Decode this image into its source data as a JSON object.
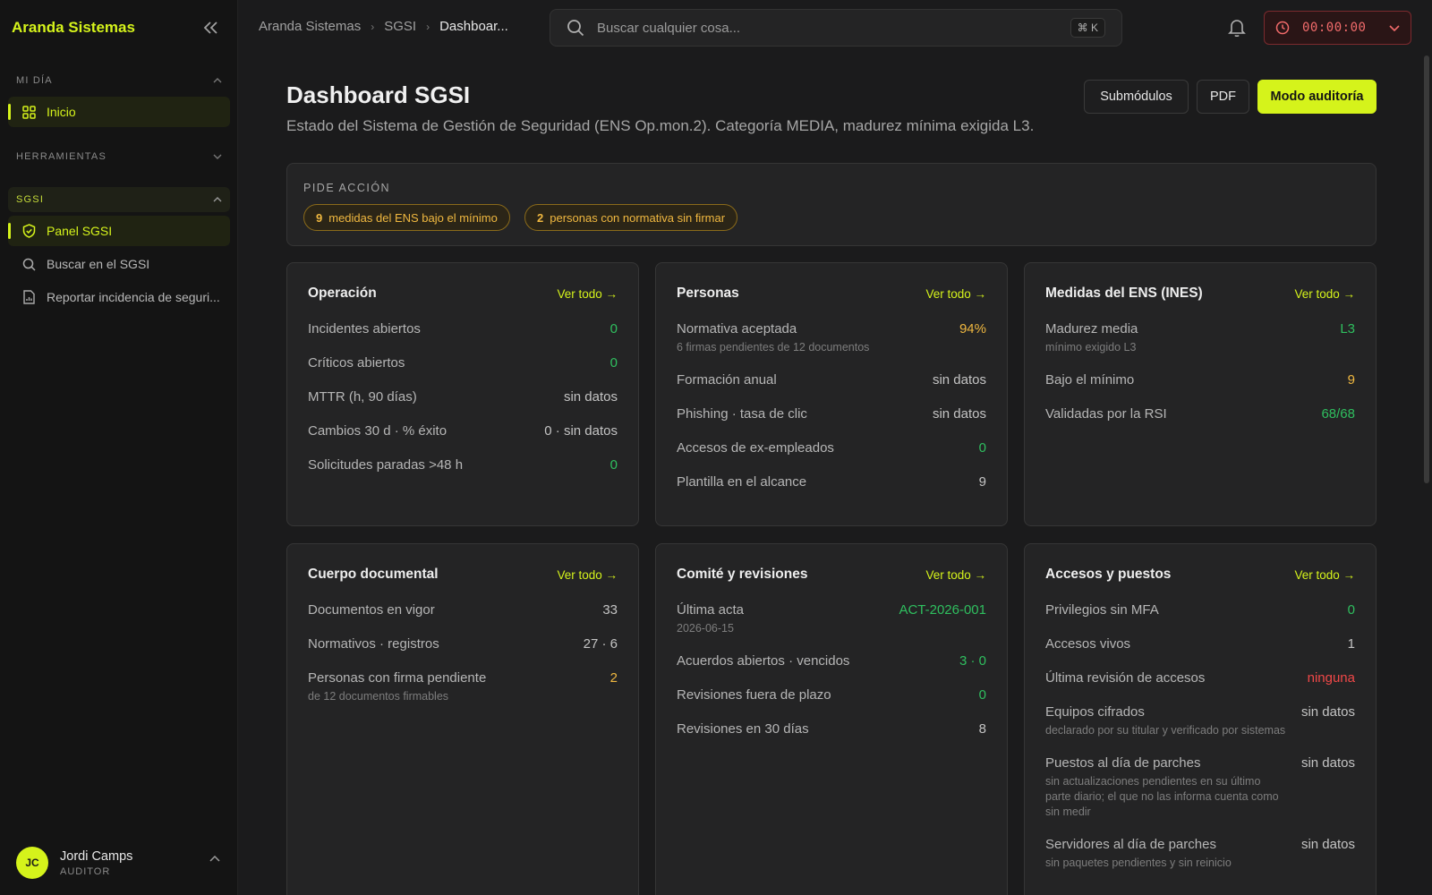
{
  "app": {
    "brand": "Aranda Sistemas"
  },
  "sidebar": {
    "sections": [
      {
        "label": "MI DÍA"
      },
      {
        "label": "HERRAMIENTAS"
      },
      {
        "label": "SGSI"
      }
    ],
    "items": [
      {
        "label": "Inicio",
        "icon": "grid-icon"
      },
      {
        "label": "Panel SGSI",
        "icon": "shield-check-icon"
      },
      {
        "label": "Buscar en el SGSI",
        "icon": "search-icon"
      },
      {
        "label": "Reportar incidencia de seguri...",
        "icon": "document-report-icon"
      }
    ],
    "user": {
      "initials": "JC",
      "name": "Jordi Camps",
      "role": "AUDITOR"
    }
  },
  "breadcrumb": [
    "Aranda Sistemas",
    "SGSI",
    "Dashboar..."
  ],
  "search": {
    "placeholder": "Buscar cualquier cosa...",
    "shortcut": "⌘ K"
  },
  "timer": {
    "value": "00:00:00"
  },
  "page": {
    "title": "Dashboard SGSI",
    "subtitle": "Estado del Sistema de Gestión de Seguridad (ENS Op.mon.2). Categoría MEDIA, madurez mínima exigida L3.",
    "buttons": {
      "submodules": "Submódulos",
      "pdf": "PDF",
      "audit": "Modo auditoría"
    }
  },
  "action_banner": {
    "title": "PIDE ACCIÓN",
    "pills": [
      {
        "count": "9",
        "text": "medidas del ENS bajo el mínimo"
      },
      {
        "count": "2",
        "text": "personas con normativa sin firmar"
      }
    ]
  },
  "cards": {
    "link_label": "Ver todo →",
    "operacion": {
      "title": "Operación",
      "rows": [
        {
          "label": "Incidentes abiertos",
          "value": "0"
        },
        {
          "label": "Críticos abiertos",
          "value": "0"
        },
        {
          "label": "MTTR (h, 90 días)",
          "value": "sin datos"
        },
        {
          "label": "Cambios 30 d · % éxito",
          "value": "0 · sin datos"
        },
        {
          "label": "Solicitudes paradas >48 h",
          "value": "0"
        }
      ]
    },
    "personas": {
      "title": "Personas",
      "rows": [
        {
          "label": "Normativa aceptada",
          "sub": "6 firmas pendientes de 12 documentos",
          "value": "94%"
        },
        {
          "label": "Formación anual",
          "value": "sin datos"
        },
        {
          "label": "Phishing · tasa de clic",
          "value": "sin datos"
        },
        {
          "label": "Accesos de ex-empleados",
          "value": "0"
        },
        {
          "label": "Plantilla en el alcance",
          "value": "9"
        }
      ]
    },
    "medidas": {
      "title": "Medidas del ENS (INES)",
      "rows": [
        {
          "label": "Madurez media",
          "sub": "mínimo exigido L3",
          "value": "L3"
        },
        {
          "label": "Bajo el mínimo",
          "value": "9"
        },
        {
          "label": "Validadas por la RSI",
          "value": "68/68"
        }
      ]
    },
    "documental": {
      "title": "Cuerpo documental",
      "rows": [
        {
          "label": "Documentos en vigor",
          "value": "33"
        },
        {
          "label": "Normativos · registros",
          "value": "27 · 6"
        },
        {
          "label": "Personas con firma pendiente",
          "sub": "de 12 documentos firmables",
          "value": "2"
        }
      ]
    },
    "comite": {
      "title": "Comité y revisiones",
      "rows": [
        {
          "label": "Última acta",
          "sub": "2026-06-15",
          "value": "ACT-2026-001"
        },
        {
          "label": "Acuerdos abiertos · vencidos",
          "value": "3 · 0"
        },
        {
          "label": "Revisiones fuera de plazo",
          "value": "0"
        },
        {
          "label": "Revisiones en 30 días",
          "value": "8"
        }
      ]
    },
    "accesos": {
      "title": "Accesos y puestos",
      "rows": [
        {
          "label": "Privilegios sin MFA",
          "value": "0"
        },
        {
          "label": "Accesos vivos",
          "value": "1"
        },
        {
          "label": "Última revisión de accesos",
          "value": "ninguna"
        },
        {
          "label": "Equipos cifrados",
          "sub": "declarado por su titular y verificado por sistemas",
          "value": "sin datos"
        },
        {
          "label": "Puestos al día de parches",
          "sub": "sin actualizaciones pendientes en su último parte diario; el que no las informa cuenta como sin medir",
          "value": "sin datos"
        },
        {
          "label": "Servidores al día de parches",
          "sub": "sin paquetes pendientes y sin reinicio",
          "value": "sin datos"
        }
      ]
    }
  },
  "colors": {
    "accent": "#d5f31b",
    "good": "#2fbf5f",
    "warn": "#f0b840",
    "bad": "#f04848"
  }
}
